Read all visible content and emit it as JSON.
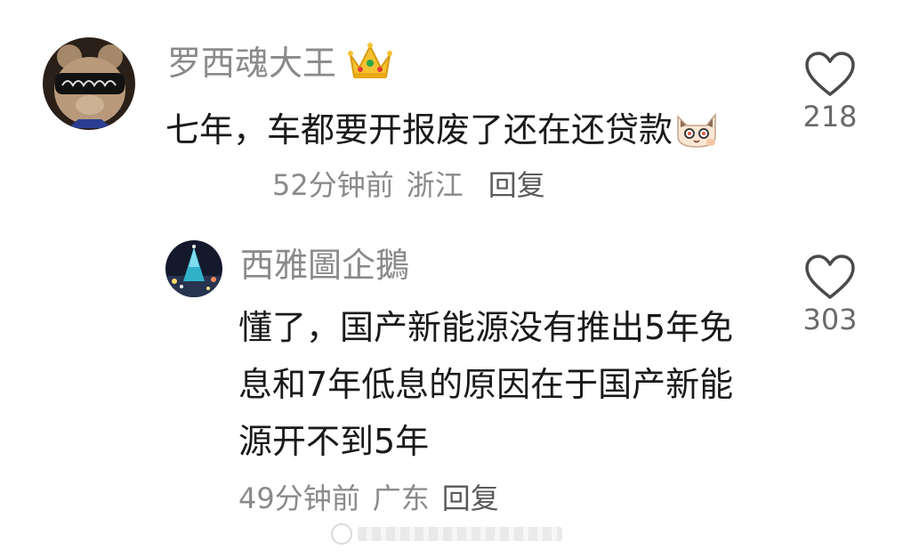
{
  "comment": {
    "username": "罗西魂大王",
    "text": "七年，车都要开报废了还在还贷款",
    "time": "52分钟前",
    "location": "浙江",
    "reply_label": "回复",
    "likes": "218",
    "icons": {
      "avatar": "teddy-bear-avatar",
      "badge": "crown-icon",
      "emoji": "cat-emoji",
      "like": "heart-outline-icon"
    }
  },
  "reply": {
    "username": "西雅圖企鵝",
    "text": "懂了，国产新能源没有推出5年免息和7年低息的原因在于国产新能源开不到5年",
    "time": "49分钟前",
    "location": "广东",
    "reply_label": "回复",
    "likes": "303",
    "icons": {
      "avatar": "night-tree-avatar",
      "like": "heart-outline-icon"
    }
  },
  "colors": {
    "text": "#1a1a1a",
    "muted": "#8a8a8a",
    "background": "#ffffff"
  }
}
